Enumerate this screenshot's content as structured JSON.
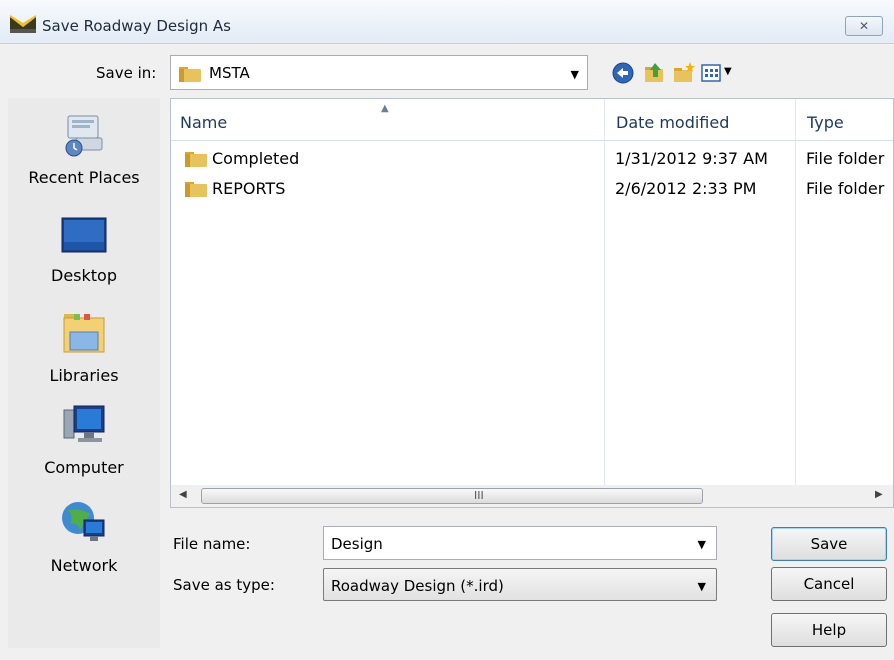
{
  "window": {
    "title": "Save Roadway Design As",
    "close_glyph": "✕"
  },
  "toolbar": {
    "save_in_label": "Save in:",
    "save_in_value": "MSTA",
    "icons": [
      "back-icon",
      "up-folder-icon",
      "new-folder-icon",
      "view-menu-icon"
    ]
  },
  "places": [
    {
      "label": "Recent Places",
      "icon": "recent-places-icon"
    },
    {
      "label": "Desktop",
      "icon": "desktop-icon"
    },
    {
      "label": "Libraries",
      "icon": "libraries-icon"
    },
    {
      "label": "Computer",
      "icon": "computer-icon"
    },
    {
      "label": "Network",
      "icon": "network-icon"
    }
  ],
  "file_list": {
    "columns": [
      "Name",
      "Date modified",
      "Type"
    ],
    "rows": [
      {
        "name": "Completed",
        "date": "1/31/2012 9:37 AM",
        "type": "File folder"
      },
      {
        "name": "REPORTS",
        "date": "2/6/2012 2:33 PM",
        "type": "File folder"
      }
    ],
    "scroll_grip": "III"
  },
  "form": {
    "file_name_label": "File name:",
    "file_name_value": "Design",
    "save_as_type_label": "Save as type:",
    "save_as_type_value": "Roadway Design (*.ird)"
  },
  "buttons": {
    "save": "Save",
    "cancel": "Cancel",
    "help": "Help"
  },
  "colors": {
    "folder": "#e8c25a",
    "accent": "#3c7fb1"
  }
}
